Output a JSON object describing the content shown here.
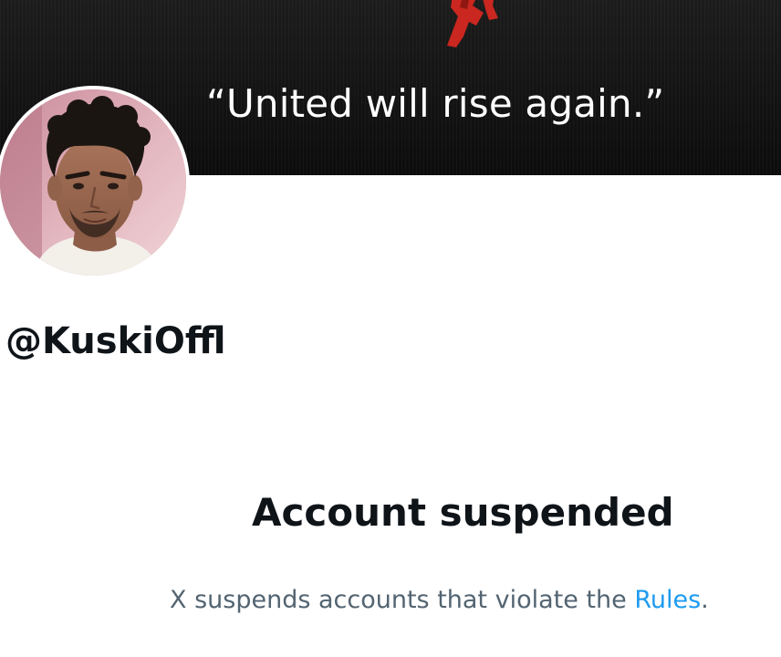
{
  "banner": {
    "quote": "“United will rise again.”"
  },
  "profile": {
    "avatar_icon": "profile-avatar",
    "handle": "@KuskiOffl"
  },
  "suspension": {
    "title": "Account suspended",
    "message_prefix": "X suspends accounts that violate the ",
    "rules_link": "Rules",
    "message_suffix": "."
  },
  "colors": {
    "text_primary": "#0f1419",
    "text_secondary": "#536471",
    "link": "#1d9bf0",
    "banner_background": "#141414"
  }
}
